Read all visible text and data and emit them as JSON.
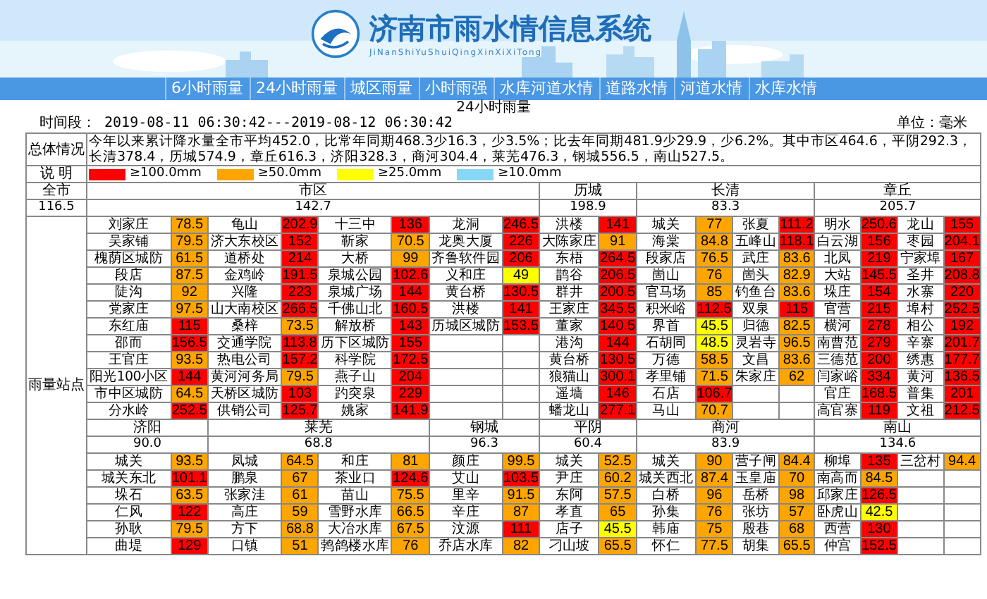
{
  "header": {
    "title": "济南市雨水情信息系统",
    "subtitle": "JiNanShiYuShuiQingXinXiXiTong"
  },
  "nav": [
    {
      "label": "6小时雨量",
      "selected": false
    },
    {
      "label": "24小时雨量",
      "selected": false
    },
    {
      "label": "城区雨量",
      "selected": false
    },
    {
      "label": "小时雨强",
      "selected": false
    },
    {
      "label": "水库河道水情",
      "selected": false
    },
    {
      "label": "道路水情",
      "selected": false
    },
    {
      "label": "河道水情",
      "selected": false
    },
    {
      "label": "水库水情",
      "selected": false
    }
  ],
  "report_title": "24小时雨量",
  "period": "时间段：  2019-08-11 06:30:42---2019-08-12 06:30:42",
  "unit": "单位：毫米",
  "summary": {
    "label": "总体情况",
    "text": "今年以来累计降水量全市平均452.0，比常年同期468.3少16.3，少3.5%；比去年同期481.9少29.9，少6.2%。其中市区464.6，平阴292.3，长清378.4，历城574.9，章丘616.3，济阳328.3，商河304.4，莱芜476.3，钢城556.5，南山527.5。"
  },
  "legend": {
    "label": "说 明",
    "items": [
      {
        "color": "#ff0000",
        "label": "≥100.0mm"
      },
      {
        "color": "#ffa500",
        "label": "≥50.0mm"
      },
      {
        "color": "#ffff00",
        "label": "≥25.0mm"
      },
      {
        "color": "#87d7f7",
        "label": "≥10.0mm"
      }
    ]
  },
  "city": {
    "label": "全市",
    "total": "116.5"
  },
  "stations_label": "雨量站点",
  "sections": [
    {
      "districts": [
        {
          "name": "市区",
          "total": "142.7",
          "columns": [
            [
              {
                "name": "刘家庄",
                "value": "78.5",
                "color": "#ffa500"
              },
              {
                "name": "吴家铺",
                "value": "79.5",
                "color": "#ffa500"
              },
              {
                "name": "槐荫区城防",
                "value": "61.5",
                "color": "#ffa500"
              },
              {
                "name": "段店",
                "value": "87.5",
                "color": "#ffa500"
              },
              {
                "name": "陡沟",
                "value": "92",
                "color": "#ffa500"
              },
              {
                "name": "党家庄",
                "value": "97.5",
                "color": "#ffa500"
              },
              {
                "name": "东红庙",
                "value": "115",
                "color": "#ff0000"
              },
              {
                "name": "邵而",
                "value": "156.5",
                "color": "#ff0000"
              },
              {
                "name": "王官庄",
                "value": "93.5",
                "color": "#ffa500"
              },
              {
                "name": "阳光100小区",
                "value": "144",
                "color": "#ff0000"
              },
              {
                "name": "市中区城防",
                "value": "64.5",
                "color": "#ffa500"
              },
              {
                "name": "分水岭",
                "value": "252.5",
                "color": "#ff0000"
              }
            ],
            [
              {
                "name": "龟山",
                "value": "202.9",
                "color": "#ff0000"
              },
              {
                "name": "济大东校区",
                "value": "152",
                "color": "#ff0000"
              },
              {
                "name": "道桥处",
                "value": "214",
                "color": "#ff0000"
              },
              {
                "name": "金鸡岭",
                "value": "191.5",
                "color": "#ff0000"
              },
              {
                "name": "兴隆",
                "value": "223",
                "color": "#ff0000"
              },
              {
                "name": "山大南校区",
                "value": "266.5",
                "color": "#ff0000"
              },
              {
                "name": "桑梓",
                "value": "73.5",
                "color": "#ffa500"
              },
              {
                "name": "交通学院",
                "value": "113.8",
                "color": "#ff0000"
              },
              {
                "name": "热电公司",
                "value": "157.2",
                "color": "#ff0000"
              },
              {
                "name": "黄河河务局",
                "value": "79.5",
                "color": "#ffa500"
              },
              {
                "name": "天桥区城防",
                "value": "103",
                "color": "#ff0000"
              },
              {
                "name": "供销公司",
                "value": "125.7",
                "color": "#ff0000"
              }
            ],
            [
              {
                "name": "十三中",
                "value": "136",
                "color": "#ff0000"
              },
              {
                "name": "靳家",
                "value": "70.5",
                "color": "#ffa500"
              },
              {
                "name": "大桥",
                "value": "99",
                "color": "#ffa500"
              },
              {
                "name": "泉城公园",
                "value": "102.6",
                "color": "#ff0000"
              },
              {
                "name": "泉城广场",
                "value": "144",
                "color": "#ff0000"
              },
              {
                "name": "千佛山北",
                "value": "160.5",
                "color": "#ff0000"
              },
              {
                "name": "解放桥",
                "value": "143",
                "color": "#ff0000"
              },
              {
                "name": "历下区城防",
                "value": "155",
                "color": "#ff0000"
              },
              {
                "name": "科学院",
                "value": "172.5",
                "color": "#ff0000"
              },
              {
                "name": "燕子山",
                "value": "204",
                "color": "#ff0000"
              },
              {
                "name": "趵突泉",
                "value": "229",
                "color": "#ff0000"
              },
              {
                "name": "姚家",
                "value": "141.9",
                "color": "#ff0000"
              }
            ],
            [
              {
                "name": "龙洞",
                "value": "246.5",
                "color": "#ff0000"
              },
              {
                "name": "龙奥大厦",
                "value": "226",
                "color": "#ff0000"
              },
              {
                "name": "齐鲁软件园",
                "value": "206",
                "color": "#ff0000"
              },
              {
                "name": "义和庄",
                "value": "49",
                "color": "#ffff00"
              },
              {
                "name": "黄台桥",
                "value": "130.5",
                "color": "#ff0000"
              },
              {
                "name": "洪楼",
                "value": "141",
                "color": "#ff0000"
              },
              {
                "name": "历城区城防",
                "value": "153.5",
                "color": "#ff0000"
              }
            ]
          ]
        },
        {
          "name": "历城",
          "total": "198.9",
          "columns": [
            [
              {
                "name": "洪楼",
                "value": "141",
                "color": "#ff0000"
              },
              {
                "name": "大陈家庄",
                "value": "91",
                "color": "#ffa500"
              },
              {
                "name": "东梧",
                "value": "264.5",
                "color": "#ff0000"
              },
              {
                "name": "鹊谷",
                "value": "206.5",
                "color": "#ff0000"
              },
              {
                "name": "群井",
                "value": "200.5",
                "color": "#ff0000"
              },
              {
                "name": "王家庄",
                "value": "345.5",
                "color": "#ff0000"
              },
              {
                "name": "董家",
                "value": "140.5",
                "color": "#ff0000"
              },
              {
                "name": "港沟",
                "value": "144",
                "color": "#ff0000"
              },
              {
                "name": "黄台桥",
                "value": "130.5",
                "color": "#ff0000"
              },
              {
                "name": "狼猫山",
                "value": "300.1",
                "color": "#ff0000"
              },
              {
                "name": "遥墙",
                "value": "146",
                "color": "#ff0000"
              },
              {
                "name": "蟠龙山",
                "value": "277.1",
                "color": "#ff0000"
              }
            ]
          ]
        },
        {
          "name": "长清",
          "total": "83.3",
          "columns": [
            [
              {
                "name": "城关",
                "value": "77",
                "color": "#ffa500"
              },
              {
                "name": "海棠",
                "value": "84.8",
                "color": "#ffa500"
              },
              {
                "name": "段家店",
                "value": "76.5",
                "color": "#ffa500"
              },
              {
                "name": "崮山",
                "value": "76",
                "color": "#ffa500"
              },
              {
                "name": "官马场",
                "value": "85",
                "color": "#ffa500"
              },
              {
                "name": "积米峪",
                "value": "112.5",
                "color": "#ff0000"
              },
              {
                "name": "界首",
                "value": "45.5",
                "color": "#ffff00"
              },
              {
                "name": "石胡同",
                "value": "48.5",
                "color": "#ffff00"
              },
              {
                "name": "万德",
                "value": "58.5",
                "color": "#ffa500"
              },
              {
                "name": "孝里铺",
                "value": "71.5",
                "color": "#ffa500"
              },
              {
                "name": "石店",
                "value": "106.7",
                "color": "#ff0000"
              },
              {
                "name": "马山",
                "value": "70.7",
                "color": "#ffa500"
              }
            ],
            [
              {
                "name": "张夏",
                "value": "111.2",
                "color": "#ff0000"
              },
              {
                "name": "五峰山",
                "value": "118.1",
                "color": "#ff0000"
              },
              {
                "name": "武庄",
                "value": "83.6",
                "color": "#ffa500"
              },
              {
                "name": "崮头",
                "value": "82.9",
                "color": "#ffa500"
              },
              {
                "name": "钓鱼台",
                "value": "83.6",
                "color": "#ffa500"
              },
              {
                "name": "双泉",
                "value": "115",
                "color": "#ff0000"
              },
              {
                "name": "归德",
                "value": "82.5",
                "color": "#ffa500"
              },
              {
                "name": "灵岩寺",
                "value": "96.5",
                "color": "#ffa500"
              },
              {
                "name": "文昌",
                "value": "83.6",
                "color": "#ffa500"
              },
              {
                "name": "朱家庄",
                "value": "62",
                "color": "#ffa500"
              }
            ]
          ]
        },
        {
          "name": "章丘",
          "total": "205.7",
          "columns": [
            [
              {
                "name": "明水",
                "value": "250.6",
                "color": "#ff0000"
              },
              {
                "name": "白云湖",
                "value": "156",
                "color": "#ff0000"
              },
              {
                "name": "北凤",
                "value": "219",
                "color": "#ff0000"
              },
              {
                "name": "大站",
                "value": "145.5",
                "color": "#ff0000"
              },
              {
                "name": "垛庄",
                "value": "154",
                "color": "#ff0000"
              },
              {
                "name": "官营",
                "value": "215",
                "color": "#ff0000"
              },
              {
                "name": "横河",
                "value": "278",
                "color": "#ff0000"
              },
              {
                "name": "南曹范",
                "value": "279",
                "color": "#ff0000"
              },
              {
                "name": "三德范",
                "value": "200",
                "color": "#ff0000"
              },
              {
                "name": "闫家峪",
                "value": "334",
                "color": "#ff0000"
              },
              {
                "name": "官庄",
                "value": "168.5",
                "color": "#ff0000"
              },
              {
                "name": "高官寨",
                "value": "119",
                "color": "#ff0000"
              }
            ],
            [
              {
                "name": "龙山",
                "value": "155",
                "color": "#ff0000"
              },
              {
                "name": "枣园",
                "value": "204.1",
                "color": "#ff0000"
              },
              {
                "name": "宁家埠",
                "value": "167",
                "color": "#ff0000"
              },
              {
                "name": "圣井",
                "value": "208.8",
                "color": "#ff0000"
              },
              {
                "name": "水寨",
                "value": "220",
                "color": "#ff0000"
              },
              {
                "name": "埠村",
                "value": "252.5",
                "color": "#ff0000"
              },
              {
                "name": "相公",
                "value": "192",
                "color": "#ff0000"
              },
              {
                "name": "辛寨",
                "value": "201.7",
                "color": "#ff0000"
              },
              {
                "name": "绣惠",
                "value": "177.7",
                "color": "#ff0000"
              },
              {
                "name": "黄河",
                "value": "136.5",
                "color": "#ff0000"
              },
              {
                "name": "普集",
                "value": "201",
                "color": "#ff0000"
              },
              {
                "name": "文祖",
                "value": "212.5",
                "color": "#ff0000"
              }
            ]
          ]
        }
      ]
    },
    {
      "districts": [
        {
          "name": "济阳",
          "total": "90.0",
          "columns": [
            [
              {
                "name": "城关",
                "value": "93.5",
                "color": "#ffa500"
              },
              {
                "name": "城关东北",
                "value": "101.1",
                "color": "#ff0000"
              },
              {
                "name": "垛石",
                "value": "63.5",
                "color": "#ffa500"
              },
              {
                "name": "仁风",
                "value": "122",
                "color": "#ff0000"
              },
              {
                "name": "孙耿",
                "value": "79.5",
                "color": "#ffa500"
              },
              {
                "name": "曲堤",
                "value": "129",
                "color": "#ff0000"
              }
            ]
          ]
        },
        {
          "name": "莱芜",
          "total": "68.8",
          "columns": [
            [
              {
                "name": "凤城",
                "value": "64.5",
                "color": "#ffa500"
              },
              {
                "name": "鹏泉",
                "value": "67",
                "color": "#ffa500"
              },
              {
                "name": "张家洼",
                "value": "61",
                "color": "#ffa500"
              },
              {
                "name": "高庄",
                "value": "59",
                "color": "#ffa500"
              },
              {
                "name": "方下",
                "value": "68.8",
                "color": "#ffa500"
              },
              {
                "name": "口镇",
                "value": "51",
                "color": "#ffa500"
              }
            ],
            [
              {
                "name": "和庄",
                "value": "81",
                "color": "#ffa500"
              },
              {
                "name": "茶业口",
                "value": "124.6",
                "color": "#ff0000"
              },
              {
                "name": "苗山",
                "value": "75.5",
                "color": "#ffa500"
              },
              {
                "name": "雪野水库",
                "value": "66.5",
                "color": "#ffa500"
              },
              {
                "name": "大冶水库",
                "value": "67.5",
                "color": "#ffa500"
              },
              {
                "name": "鹁鸽楼水库",
                "value": "76",
                "color": "#ffa500"
              }
            ]
          ]
        },
        {
          "name": "钢城",
          "total": "96.3",
          "columns": [
            [
              {
                "name": "颜庄",
                "value": "99.5",
                "color": "#ffa500"
              },
              {
                "name": "艾山",
                "value": "103.5",
                "color": "#ff0000"
              },
              {
                "name": "里辛",
                "value": "91.5",
                "color": "#ffa500"
              },
              {
                "name": "辛庄",
                "value": "87",
                "color": "#ffa500"
              },
              {
                "name": "汶源",
                "value": "111",
                "color": "#ff0000"
              },
              {
                "name": "乔店水库",
                "value": "82",
                "color": "#ffa500"
              }
            ]
          ]
        },
        {
          "name": "平阴",
          "total": "60.4",
          "columns": [
            [
              {
                "name": "城关",
                "value": "52.5",
                "color": "#ffa500"
              },
              {
                "name": "尹庄",
                "value": "60.2",
                "color": "#ffa500"
              },
              {
                "name": "东阿",
                "value": "57.5",
                "color": "#ffa500"
              },
              {
                "name": "孝直",
                "value": "65",
                "color": "#ffa500"
              },
              {
                "name": "店子",
                "value": "45.5",
                "color": "#ffff00"
              },
              {
                "name": "刁山坡",
                "value": "65.5",
                "color": "#ffa500"
              }
            ]
          ]
        },
        {
          "name": "商河",
          "total": "83.9",
          "columns": [
            [
              {
                "name": "城关",
                "value": "90",
                "color": "#ffa500"
              },
              {
                "name": "城关西北",
                "value": "87.4",
                "color": "#ffa500"
              },
              {
                "name": "白桥",
                "value": "96",
                "color": "#ffa500"
              },
              {
                "name": "孙集",
                "value": "76",
                "color": "#ffa500"
              },
              {
                "name": "韩庙",
                "value": "75",
                "color": "#ffa500"
              },
              {
                "name": "怀仁",
                "value": "77.5",
                "color": "#ffa500"
              }
            ],
            [
              {
                "name": "营子闸",
                "value": "84.4",
                "color": "#ffa500"
              },
              {
                "name": "玉皇庙",
                "value": "70",
                "color": "#ffa500"
              },
              {
                "name": "岳桥",
                "value": "98",
                "color": "#ffa500"
              },
              {
                "name": "张坊",
                "value": "57",
                "color": "#ffa500"
              },
              {
                "name": "殷巷",
                "value": "68",
                "color": "#ffa500"
              },
              {
                "name": "胡集",
                "value": "65.5",
                "color": "#ffa500"
              }
            ]
          ]
        },
        {
          "name": "南山",
          "total": "134.6",
          "columns": [
            [
              {
                "name": "柳埠",
                "value": "135",
                "color": "#ff0000"
              },
              {
                "name": "南高而",
                "value": "84.5",
                "color": "#ffa500"
              },
              {
                "name": "邱家庄",
                "value": "126.5",
                "color": "#ff0000"
              },
              {
                "name": "卧虎山",
                "value": "42.5",
                "color": "#ffff00"
              },
              {
                "name": "西营",
                "value": "130",
                "color": "#ff0000"
              },
              {
                "name": "仲宫",
                "value": "152.5",
                "color": "#ff0000"
              }
            ],
            [
              {
                "name": "三岔村",
                "value": "94.4",
                "color": "#ffa500"
              }
            ]
          ]
        }
      ]
    }
  ]
}
